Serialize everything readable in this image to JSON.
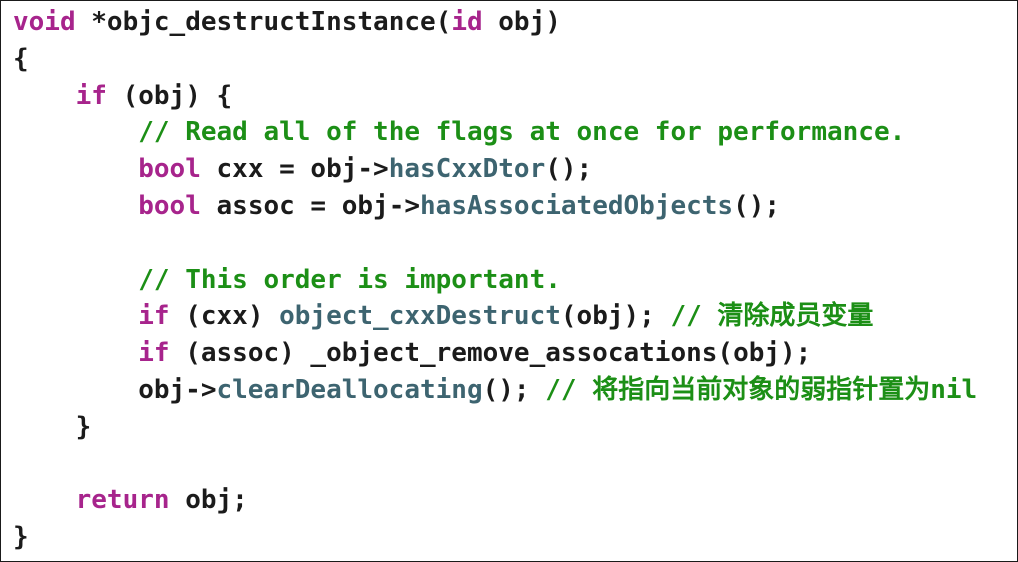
{
  "editor": {
    "lines": [
      [
        {
          "t": "void",
          "c": "kw"
        },
        {
          "t": " *objc_destructInstance(",
          "c": "pl"
        },
        {
          "t": "id",
          "c": "kw"
        },
        {
          "t": " obj)",
          "c": "pl"
        }
      ],
      [
        {
          "t": "{",
          "c": "pl"
        }
      ],
      [
        {
          "t": "    ",
          "c": "pl"
        },
        {
          "t": "if",
          "c": "kw"
        },
        {
          "t": " (obj) {",
          "c": "pl"
        }
      ],
      [
        {
          "t": "        ",
          "c": "pl"
        },
        {
          "t": "// Read all of the flags at once for performance.",
          "c": "cm"
        }
      ],
      [
        {
          "t": "        ",
          "c": "pl"
        },
        {
          "t": "bool",
          "c": "kw"
        },
        {
          "t": " cxx = obj->",
          "c": "pl"
        },
        {
          "t": "hasCxxDtor",
          "c": "fn"
        },
        {
          "t": "();",
          "c": "pl"
        }
      ],
      [
        {
          "t": "        ",
          "c": "pl"
        },
        {
          "t": "bool",
          "c": "kw"
        },
        {
          "t": " assoc = obj->",
          "c": "pl"
        },
        {
          "t": "hasAssociatedObjects",
          "c": "fn"
        },
        {
          "t": "();",
          "c": "pl"
        }
      ],
      [],
      [
        {
          "t": "        ",
          "c": "pl"
        },
        {
          "t": "// This order is important.",
          "c": "cm"
        }
      ],
      [
        {
          "t": "        ",
          "c": "pl"
        },
        {
          "t": "if",
          "c": "kw"
        },
        {
          "t": " (cxx) ",
          "c": "pl"
        },
        {
          "t": "object_cxxDestruct",
          "c": "fn"
        },
        {
          "t": "(obj); ",
          "c": "pl"
        },
        {
          "t": "// 清除成员变量",
          "c": "cm"
        }
      ],
      [
        {
          "t": "        ",
          "c": "pl"
        },
        {
          "t": "if",
          "c": "kw"
        },
        {
          "t": " (assoc) _object_remove_assocations(obj);",
          "c": "pl"
        }
      ],
      [
        {
          "t": "        obj->",
          "c": "pl"
        },
        {
          "t": "clearDeallocating",
          "c": "fn"
        },
        {
          "t": "(); ",
          "c": "pl"
        },
        {
          "t": "// 将指向当前对象的弱指针置为nil",
          "c": "cm"
        }
      ],
      [
        {
          "t": "    }",
          "c": "pl"
        }
      ],
      [],
      [
        {
          "t": "    ",
          "c": "pl"
        },
        {
          "t": "return",
          "c": "kw"
        },
        {
          "t": " obj;",
          "c": "pl"
        }
      ],
      [
        {
          "t": "}",
          "c": "pl"
        }
      ]
    ],
    "colors": {
      "keyword": "#a7248c",
      "function": "#3d6470",
      "comment": "#1c8f16",
      "plain": "#1b1b1b",
      "background": "#ffffff",
      "border": "#1a1a1a"
    }
  }
}
